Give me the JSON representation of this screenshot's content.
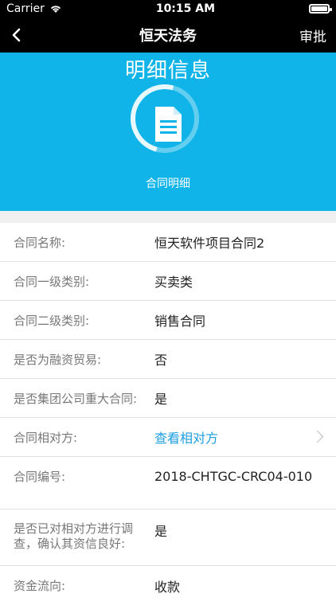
{
  "status_bar": {
    "carrier": "Carrier",
    "time": "10:15 AM"
  },
  "nav": {
    "back_label": "<",
    "title": "恒天法务",
    "approve_label": "审批"
  },
  "hero": {
    "headline": "明细信息",
    "caption": "合同明细",
    "icon": "document-icon"
  },
  "details": [
    {
      "label": "合同名称:",
      "value": "恒天软件项目合同2"
    },
    {
      "label": "合同一级类别:",
      "value": "买卖类"
    },
    {
      "label": "合同二级类别:",
      "value": "销售合同"
    },
    {
      "label": "是否为融资贸易:",
      "value": "否"
    },
    {
      "label": "是否集团公司重大合同:",
      "value": "是"
    },
    {
      "label": "合同相对方:",
      "value": "查看相对方",
      "link": true
    },
    {
      "label": "合同编号:",
      "value": "2018-CHTGC-CRC04-010"
    },
    {
      "label": "是否已对相对方进行调查，确认其资信良好:",
      "value": "是"
    },
    {
      "label": "资金流向:",
      "value": "收款"
    }
  ],
  "colors": {
    "header_bg": "#000000",
    "hero_bg": "#10b4e8",
    "link": "#1d9ee0"
  }
}
